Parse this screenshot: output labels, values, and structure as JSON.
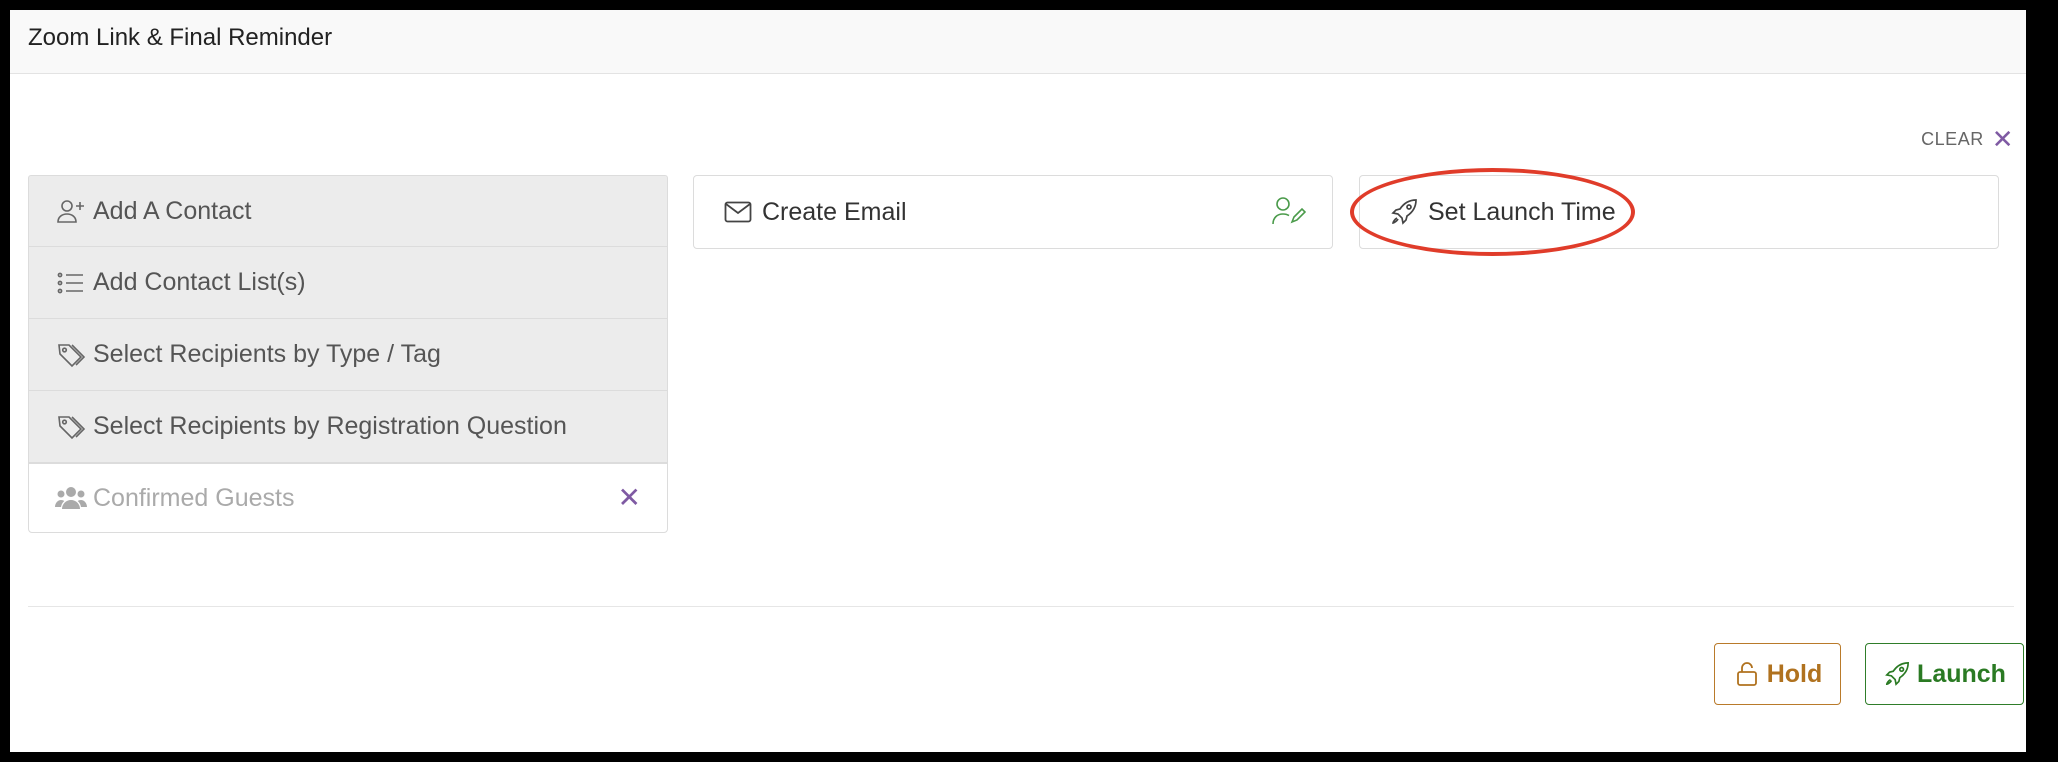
{
  "header": {
    "title": "Zoom Link & Final Reminder"
  },
  "clear": {
    "label": "CLEAR",
    "icon": "close-icon"
  },
  "recipients": {
    "items": [
      {
        "label": "Add A Contact",
        "icon": "user-plus-icon"
      },
      {
        "label": "Add Contact List(s)",
        "icon": "list-icon"
      },
      {
        "label": "Select Recipients by Type / Tag",
        "icon": "tags-icon"
      },
      {
        "label": "Select Recipients by Registration Question",
        "icon": "tags-icon"
      }
    ],
    "selected": {
      "label": "Confirmed Guests",
      "icon": "users-icon"
    }
  },
  "email_card": {
    "label": "Create Email",
    "icon": "envelope-icon",
    "edit_icon": "user-edit-icon"
  },
  "launch_time_card": {
    "label": "Set Launch Time",
    "icon": "rocket-icon"
  },
  "actions": {
    "hold": {
      "label": "Hold",
      "icon": "unlock-icon",
      "color": "#b0721f"
    },
    "launch": {
      "label": "Launch",
      "icon": "rocket-icon",
      "color": "#2a7a23"
    }
  },
  "colors": {
    "accent": "#7f5aa3",
    "annotation": "#e03c2a"
  }
}
